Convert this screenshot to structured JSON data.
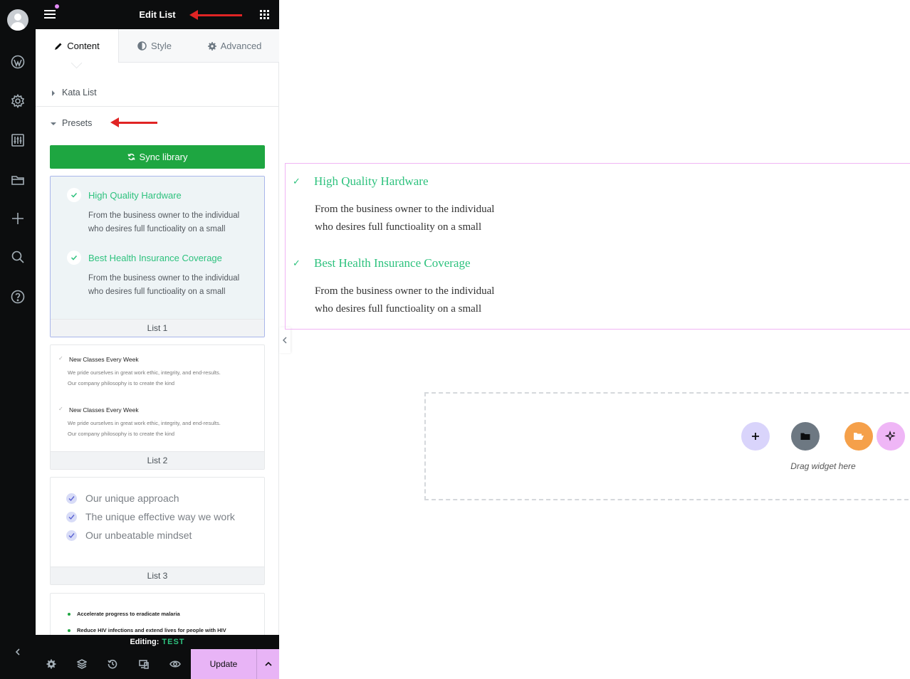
{
  "header": {
    "title": "Edit List"
  },
  "tabs": [
    {
      "label": "Content",
      "icon": "pencil-icon"
    },
    {
      "label": "Style",
      "icon": "half-circle-icon"
    },
    {
      "label": "Advanced",
      "icon": "gear-icon"
    }
  ],
  "sections": {
    "kata": "Kata List",
    "presets": "Presets"
  },
  "sync_label": "Sync library",
  "preset1": {
    "label": "List 1",
    "items": [
      {
        "title": "High Quality Hardware",
        "desc1": "From the business owner to the individual",
        "desc2": "who desires full functioality on a small"
      },
      {
        "title": "Best Health Insurance Coverage",
        "desc1": "From the business owner to the individual",
        "desc2": "who desires full functioality on a small"
      }
    ]
  },
  "preset2": {
    "label": "List 2",
    "items": [
      {
        "title": "New Classes Every Week",
        "desc1": "We pride ourselves in great work ethic, integrity, and end-results.",
        "desc2": "Our company philosophy is to create the kind"
      },
      {
        "title": "New Classes Every Week",
        "desc1": "We pride ourselves in great work ethic, integrity, and end-results.",
        "desc2": "Our company philosophy is to create the kind"
      }
    ]
  },
  "preset3": {
    "label": "List 3",
    "items": [
      "Our unique approach",
      "The unique effective way we work",
      "Our unbeatable mindset"
    ]
  },
  "preset4": {
    "items": [
      "Accelerate progress to eradicate malaria",
      "Reduce HIV infections and extend lives for people with HIV"
    ]
  },
  "editing": {
    "label": "Editing:",
    "doc": "TEST"
  },
  "update_label": "Update",
  "widget": {
    "items": [
      {
        "title": "High Quality Hardware",
        "desc1": "From the business owner to the individual",
        "desc2": "who desires full functioality on a small"
      },
      {
        "title": "Best Health Insurance Coverage",
        "desc1": "From the business owner to the individual",
        "desc2": "who desires full functioality on a small"
      }
    ]
  },
  "dropzone_text": "Drag widget here",
  "colors": {
    "accent_green": "#2ec27e",
    "sync_green": "#1ea641",
    "update_pink": "#e8b4f6",
    "widget_border": "#f0b5f5",
    "annotation_red": "#e02424"
  }
}
